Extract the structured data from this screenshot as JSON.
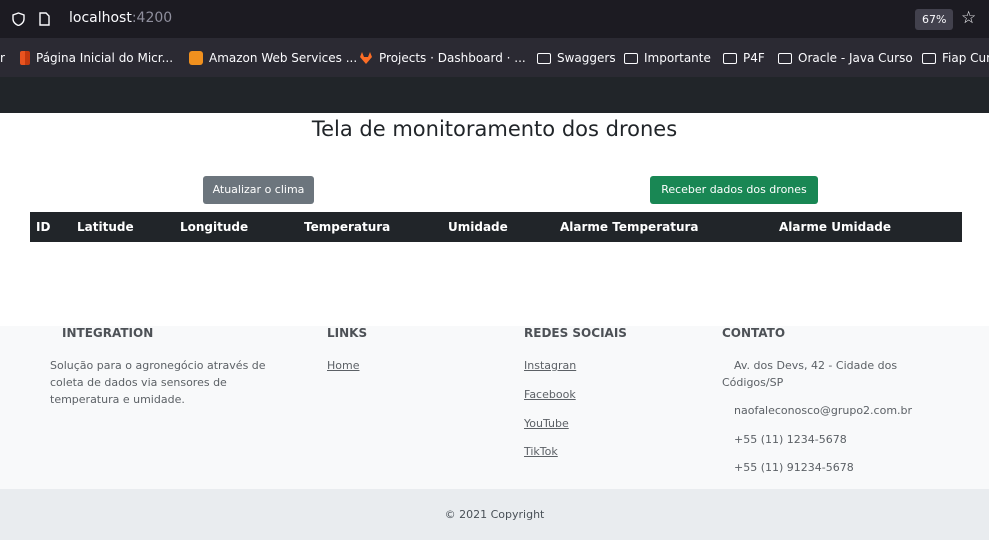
{
  "browser": {
    "url_host": "localhost",
    "url_port": ":4200",
    "zoom": "67%"
  },
  "bookmarks": [
    {
      "label": "Página Inicial do Micr...",
      "icon": "office-icon"
    },
    {
      "label": "Amazon Web Services ...",
      "icon": "aws-icon"
    },
    {
      "label": "Projects · Dashboard · ...",
      "icon": "gitlab-icon"
    },
    {
      "label": "Swaggers",
      "icon": "folder-icon"
    },
    {
      "label": "Importante",
      "icon": "folder-icon"
    },
    {
      "label": "P4F",
      "icon": "folder-icon"
    },
    {
      "label": "Oracle - Java Curso",
      "icon": "folder-icon"
    },
    {
      "label": "Fiap Curs",
      "icon": "folder-icon"
    }
  ],
  "page": {
    "title": "Tela de monitoramento dos drones",
    "btn_weather": "Atualizar o clima",
    "btn_drones": "Receber dados dos drones",
    "columns": [
      "ID",
      "Latitude",
      "Longitude",
      "Temperatura",
      "Umidade",
      "Alarme Temperatura",
      "Alarme Umidade"
    ]
  },
  "footer": {
    "integration": {
      "heading": "INTEGRATION",
      "text": "Solução para o agronegócio através de coleta de dados via sensores de temperatura e umidade."
    },
    "links": {
      "heading": "LINKS",
      "home": "Home"
    },
    "social": {
      "heading": "REDES SOCIAIS",
      "items": [
        "Instagran",
        "Facebook",
        "YouTube",
        "TikTok"
      ]
    },
    "contact": {
      "heading": "CONTATO",
      "address": "Av. dos Devs, 42 - Cidade dos Códigos/SP",
      "email": "naofaleconosco@grupo2.com.br",
      "phone1": "+55 (11) 1234-5678",
      "phone2": "+55 (11) 91234-5678"
    },
    "copyright": "© 2021 Copyright"
  },
  "colors": {
    "navbar": "#212529",
    "btn_secondary": "#6c757d",
    "btn_success": "#198754",
    "footer_bg": "#f8f9fa"
  }
}
